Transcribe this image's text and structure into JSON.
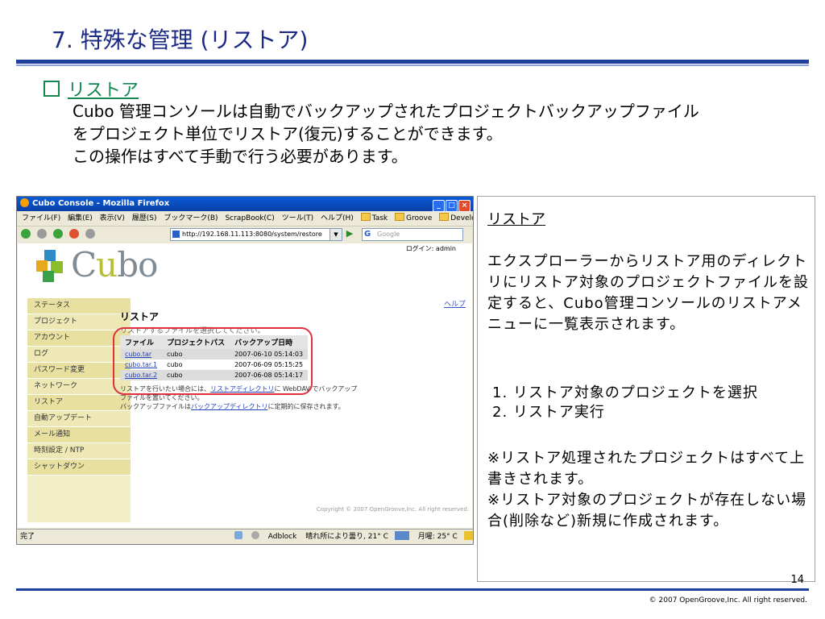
{
  "slide": {
    "title": "7. 特殊な管理 (リストア)",
    "section_heading": "リストア",
    "intro_lines": [
      "Cubo 管理コンソールは自動でバックアップされたプロジェクトバックアップファイル",
      "をプロジェクト単位でリストア(復元)することができます。",
      "この操作はすべて手動で行う必要があります。"
    ],
    "page_number": "14",
    "footer": "© 2007 OpenGroove,Inc. All right reserved."
  },
  "browser": {
    "window_title": "Cubo Console - Mozilla Firefox",
    "menu": [
      "ファイル(F)",
      "編集(E)",
      "表示(V)",
      "履歴(S)",
      "ブックマーク(B)",
      "ScrapBook(C)",
      "ツール(T)",
      "ヘルプ(H)"
    ],
    "bookmarks": [
      "Task",
      "Groove",
      "Develop"
    ],
    "url": "http://192.168.11.113:8080/system/restore",
    "search_placeholder": "Google",
    "status_left": "完了",
    "status_items": [
      "Adblock",
      "晴れ所により曇り, 21° C",
      "月曜: 25° C"
    ],
    "colors": {
      "titlebar": "#0a4fc4",
      "sidebar": "#ede8b4",
      "highlight": "#e03040"
    }
  },
  "app": {
    "login": "ログイン: admin",
    "logo": {
      "prefix": "C",
      "accent": "u",
      "suffix": "bo"
    },
    "sidebar": [
      "ステータス",
      "プロジェクト",
      "アカウント",
      "ログ",
      "パスワード変更",
      "ネットワーク",
      "リストア",
      "自動アップデート",
      "メール通知",
      "時刻設定 / NTP",
      "シャットダウン"
    ],
    "help": "ヘルプ",
    "heading": "リストア",
    "instruction": "リストアするファイルを選択してください。",
    "table": {
      "headers": [
        "ファイル",
        "プロジェクトパス",
        "バックアップ日時"
      ],
      "rows": [
        [
          "cubo.tar",
          "cubo",
          "2007-06-10 05:14:03"
        ],
        [
          "cubo.tar.1",
          "cubo",
          "2007-06-09 05:15:25"
        ],
        [
          "cubo.tar.2",
          "cubo",
          "2007-06-08 05:14:17"
        ]
      ]
    },
    "note1_a": "リストアを行いたい場合には、",
    "note1_link": "リストアディレクトリ",
    "note1_b": "に WebDAV でバックアップファイルを置いてください。",
    "note2_a": "バックアップファイルは",
    "note2_link": "バックアップディレクトリ",
    "note2_b": "に定期的に保存されます。",
    "copyright": "Copyright © 2007 OpenGroove,Inc. All right reserved."
  },
  "callout": {
    "title": "リストア",
    "description": "エクスプローラーからリストア用のディレクトリにリストア対象のプロジェクトファイルを設定すると、Cubo管理コンソールのリストアメニューに一覧表示されます。",
    "steps": [
      "1. リストア対象のプロジェクトを選択",
      "2. リストア実行"
    ],
    "notes": [
      "※リストア処理されたプロジェクトはすべて上書きされます。",
      "※リストア対象のプロジェクトが存在しない場合(削除など)新規に作成されます。"
    ]
  }
}
